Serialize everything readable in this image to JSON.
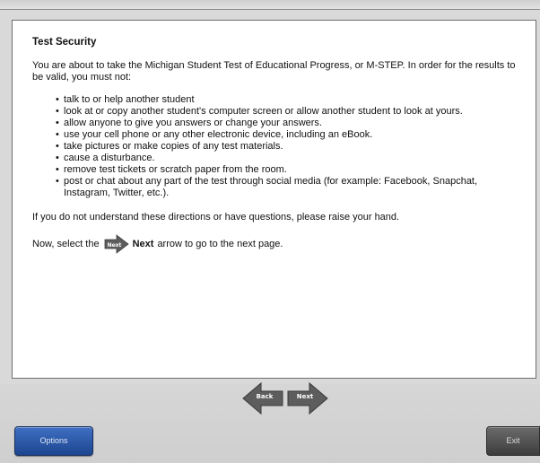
{
  "page": {
    "title": "Test Security",
    "intro": "You are about to take the Michigan Student Test of Educational Progress, or M-STEP. In order for the results to be valid, you must not:",
    "rules": [
      "talk to or help another student",
      "look at or copy another student's computer screen or allow another student to look at yours.",
      "allow anyone to give you answers or change your answers.",
      "use your cell phone or any other electronic device, including an eBook.",
      "take pictures or make copies of any test materials.",
      "cause a disturbance.",
      "remove test tickets or scratch paper from the room.",
      "post or chat about any part of the test through social media (for example: Facebook, Snapchat, Instagram, Twitter, etc.)."
    ],
    "questions_text": "If you do not understand these directions or have questions, please raise your hand.",
    "next_prefix": "Now, select the",
    "next_icon_label": "Next",
    "next_word": "Next",
    "next_suffix": "arrow to go to the next page."
  },
  "nav": {
    "back_label": "Back",
    "next_label": "Next"
  },
  "footer": {
    "options_label": "Options",
    "exit_label": "Exit"
  },
  "colors": {
    "arrow_gray": "#5d5d5d",
    "options_blue": "#2a57a8"
  }
}
